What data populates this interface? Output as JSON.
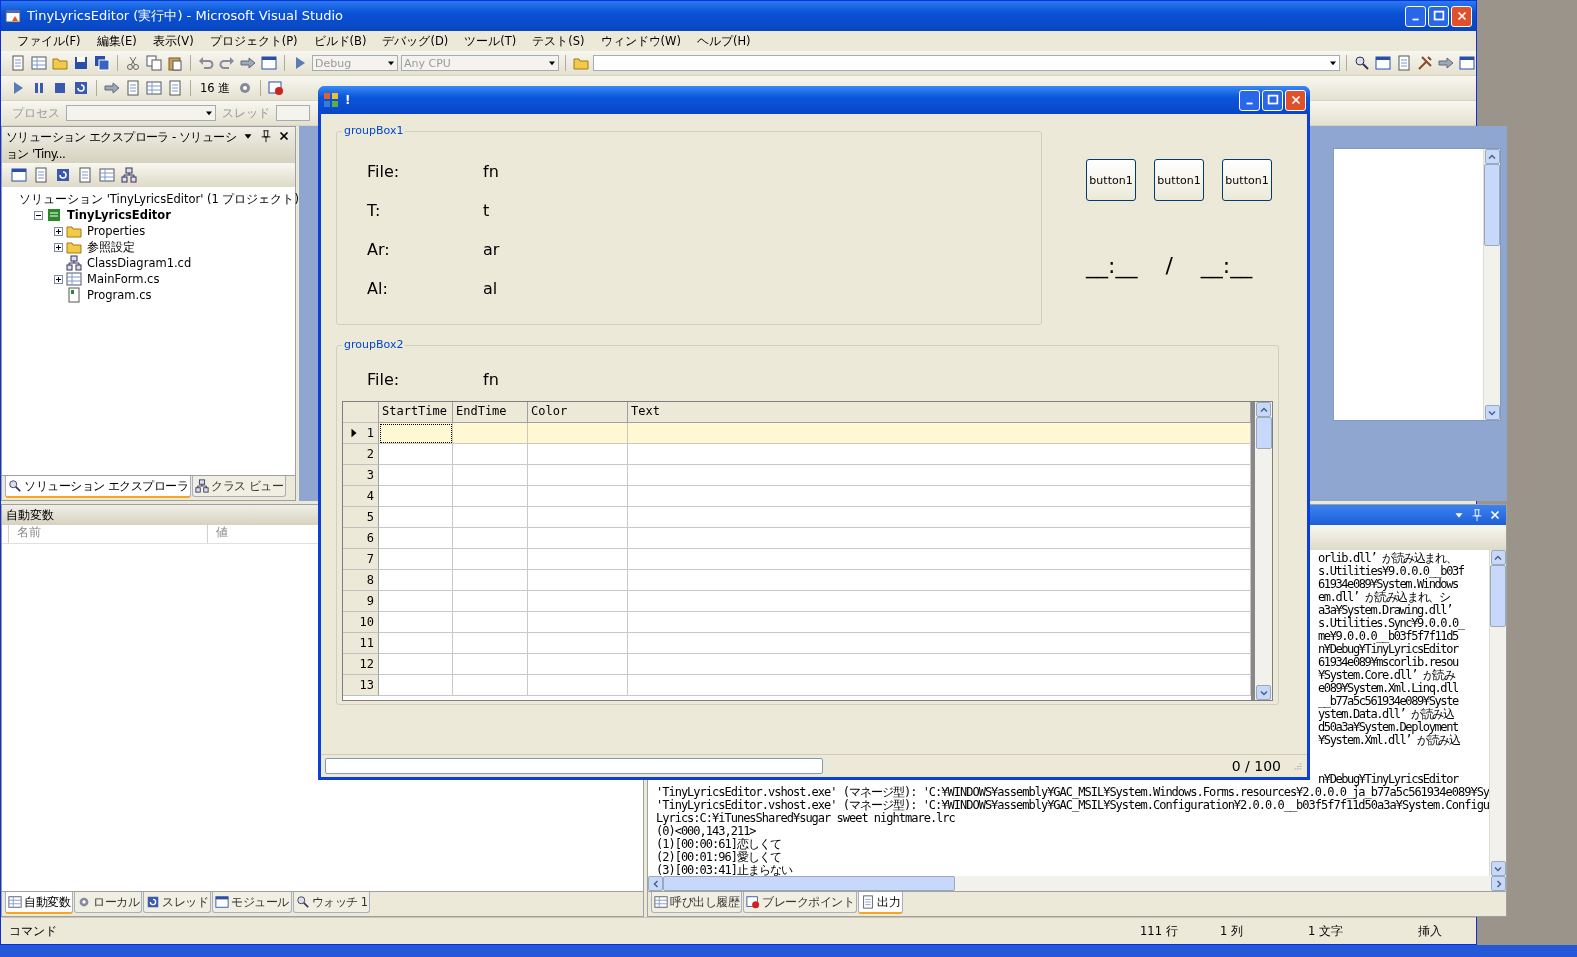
{
  "vs_window": {
    "title": "TinyLyricsEditor (実行中) - Microsoft Visual Studio"
  },
  "menu": [
    "ファイル(F)",
    "編集(E)",
    "表示(V)",
    "プロジェクト(P)",
    "ビルド(B)",
    "デバッグ(D)",
    "ツール(T)",
    "テスト(S)",
    "ウィンドウ(W)",
    "ヘルプ(H)"
  ],
  "toolbar": {
    "configuration": {
      "value": "Debug",
      "disabled": true
    },
    "platform": {
      "value": "Any CPU",
      "disabled": true
    },
    "hex_label": "16 進"
  },
  "debug_location": {
    "process_label": "プロセス",
    "thread_label": "スレッド"
  },
  "solution_explorer": {
    "title": "ソリューション エクスプローラ - ソリューション 'Tiny...",
    "tree": [
      {
        "label": "ソリューション 'TinyLyricsEditor' (1 プロジェクト)",
        "kind": "solution",
        "children": [
          {
            "label": "TinyLyricsEditor",
            "kind": "project",
            "expanded": true,
            "children": [
              {
                "label": "Properties",
                "kind": "folder",
                "expanded": false
              },
              {
                "label": "参照設定",
                "kind": "folder",
                "expanded": false
              },
              {
                "label": "ClassDiagram1.cd",
                "kind": "diagram"
              },
              {
                "label": "MainForm.cs",
                "kind": "form",
                "expanded": false
              },
              {
                "label": "Program.cs",
                "kind": "code"
              }
            ]
          }
        ]
      }
    ]
  },
  "left_tabs": [
    {
      "label": "ソリューション エクスプローラ",
      "selected": true
    },
    {
      "label": "クラス ビュー",
      "selected": false
    }
  ],
  "autos": {
    "title": "自動変数",
    "columns": [
      "名前",
      "値"
    ]
  },
  "bottom_left_tabs": [
    {
      "label": "自動変数",
      "selected": true
    },
    {
      "label": "ローカル",
      "selected": false
    },
    {
      "label": "スレッド",
      "selected": false
    },
    {
      "label": "モジュール",
      "selected": false
    },
    {
      "label": "ウォッチ 1",
      "selected": false
    }
  ],
  "output": {
    "lines": [
      {
        "text": "orlib.dll’ が読み込まれ、",
        "kind": "partial"
      },
      {
        "text": "s.Utilities¥9.0.0.0__b03f",
        "kind": "partial"
      },
      {
        "text": "61934e089¥System.Windows",
        "kind": "partial"
      },
      {
        "text": "em.dll’ が読み込まれ、シ",
        "kind": "partial"
      },
      {
        "text": "a3a¥System.Drawing.dll’",
        "kind": "partial"
      },
      {
        "text": "s.Utilities.Sync¥9.0.0.0_",
        "kind": "partial"
      },
      {
        "text": "me¥9.0.0.0__b03f5f7f11d5",
        "kind": "partial"
      },
      {
        "text": "n¥Debug¥TinyLyricsEditor",
        "kind": "partial"
      },
      {
        "text": "61934e089¥mscorlib.resou",
        "kind": "partial"
      },
      {
        "text": "¥System.Core.dll’ が読み",
        "kind": "partial"
      },
      {
        "text": "e089¥System.Xml.Linq.dll",
        "kind": "partial"
      },
      {
        "text": "__b77a5c561934e089¥Syste",
        "kind": "partial"
      },
      {
        "text": "ystem.Data.dll’ が読み込",
        "kind": "partial"
      },
      {
        "text": "d50a3a¥System.Deployment",
        "kind": "partial"
      },
      {
        "text": "¥System.Xml.dll’ が読み込",
        "kind": "partial"
      },
      {
        "text": "n¥Debug¥TinyLyricsEditor",
        "kind": "partial-gap"
      },
      {
        "text": "'TinyLyricsEditor.vshost.exe' (マネージ型): 'C:¥WINDOWS¥assembly¥GAC_MSIL¥System.Windows.Forms.resources¥2.0.0.0_ja_b77a5c561934e089¥Sy",
        "kind": "full"
      },
      {
        "text": "'TinyLyricsEditor.vshost.exe' (マネージ型): 'C:¥WINDOWS¥assembly¥GAC_MSIL¥System.Configuration¥2.0.0.0__b03f5f7f11d50a3a¥System.Configu",
        "kind": "full"
      },
      {
        "text": "Lyrics:C:¥iTunesShared¥sugar sweet nightmare.lrc",
        "kind": "full"
      },
      {
        "text": "(0)<000,143,211>",
        "kind": "full"
      },
      {
        "text": "(1)[00:00:61]恋しくて",
        "kind": "full"
      },
      {
        "text": "(2)[00:01:96]愛しくて",
        "kind": "full"
      },
      {
        "text": "(3)[00:03:41]止まらない",
        "kind": "full"
      }
    ]
  },
  "bottom_right_tabs": [
    {
      "label": "呼び出し履歴",
      "selected": false
    },
    {
      "label": "ブレークポイント",
      "selected": false
    },
    {
      "label": "出力",
      "selected": true
    }
  ],
  "status_bar": {
    "command": "コマンド",
    "line": "111 行",
    "column": "1 列",
    "character": "1 文字",
    "mode": "挿入"
  },
  "dialog": {
    "title": "!",
    "group1": {
      "title": "groupBox1",
      "fields": [
        {
          "label": "File:",
          "value": "fn"
        },
        {
          "label": "T:",
          "value": "t"
        },
        {
          "label": "Ar:",
          "value": "ar"
        },
        {
          "label": "Al:",
          "value": "al"
        }
      ]
    },
    "buttons": [
      "button1",
      "button1",
      "button1"
    ],
    "time": {
      "current": "__:__",
      "separator": "/",
      "total": "__:__"
    },
    "group2": {
      "title": "groupBox2",
      "file": {
        "label": "File:",
        "value": "fn"
      },
      "grid": {
        "columns": [
          "StartTime",
          "EndTime",
          "Color",
          "Text"
        ],
        "rows": [
          {
            "number": "1",
            "selected": true
          },
          {
            "number": "2",
            "selected": false
          },
          {
            "number": "3",
            "selected": false
          },
          {
            "number": "4",
            "selected": false
          },
          {
            "number": "5",
            "selected": false
          },
          {
            "number": "6",
            "selected": false
          },
          {
            "number": "7",
            "selected": false
          },
          {
            "number": "8",
            "selected": false
          },
          {
            "number": "9",
            "selected": false
          },
          {
            "number": "10",
            "selected": false
          },
          {
            "number": "11",
            "selected": false
          },
          {
            "number": "12",
            "selected": false
          },
          {
            "number": "13",
            "selected": false
          }
        ]
      }
    },
    "progress": {
      "level": 0
    },
    "count": "0 / 100"
  }
}
